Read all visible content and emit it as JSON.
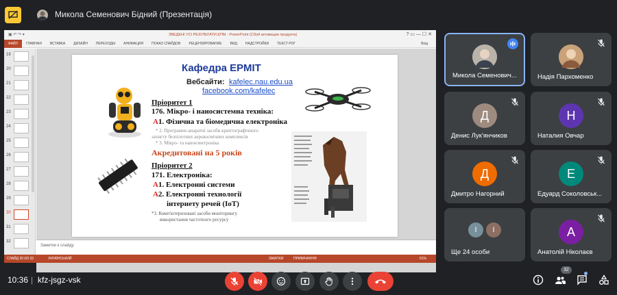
{
  "topbar": {
    "presenter_title": "Микола Семенович Бідний (Презентація)"
  },
  "powerpoint": {
    "doc_title": "ЗВЕДЕНІ УСІ РЕЗУЛЬТАТИ.ЕПМ - PowerPoint (Сбой активации продукта)",
    "file_tab": "ФАЙЛ",
    "ribbon_tabs": [
      "ГЛАВНАЯ",
      "ВСТАВКА",
      "ДИЗАЙН",
      "ПЕРЕХОДЫ",
      "АНИМАЦИЯ",
      "ПОКАЗ СЛАЙДОВ",
      "РЕЦЕНЗИРОВАНИЕ",
      "ВИД",
      "НАДСТРОЙКИ",
      "ТЕКСТ РОГ"
    ],
    "signin": "Вхід",
    "thumbnails": [
      "19",
      "20",
      "21",
      "22",
      "23",
      "24",
      "25",
      "26",
      "27",
      "28",
      "29",
      "30",
      "31",
      "32"
    ],
    "selected_thumb": "30",
    "notes_placeholder": "Заметки к слайду",
    "status_slide": "СЛАЙД 30 ИЗ 33",
    "status_lang": "УКРАЇНСЬКИЙ",
    "status_notes": "ЗАМІТКИ",
    "status_comments": "ПРИМІЧАННЯ",
    "zoom": "61%"
  },
  "slide": {
    "heading": "Кафедра ЕРМІТ",
    "websites_label": "Вебсайти:",
    "website1": "kafelec.nau.edu.ua",
    "website2": "facebook.com/kafelec",
    "priority1": "Пріоритет 1",
    "spec176": "176. Мікро- і наносистемна техніка:",
    "a1_marker": "А",
    "a1_text": "1. Фізична та біомедична електроніка",
    "prog_line1": "* 2. Програмно-апаратні засоби  криптографічного",
    "prog_line2": "захисту безпілотних  аерокосмічних комплексів",
    "micro_line": "* 3. Мікро- та наноелектроніка",
    "accredited": "Акредитовані на 5 років",
    "priority2": "Пріоритет 2",
    "spec171": "171. Електроніка:",
    "b1_marker": "А",
    "b1_text": "1. Електронні системи",
    "b2_marker": "А",
    "b2_text_line1": "2. Електронні технології",
    "b2_text_line2": "інтернету речей (IoT)",
    "comp_line1": "*3. Комп'ютеризовані засоби моніторингу",
    "comp_line2": "використання частотного ресурсу"
  },
  "participants": [
    {
      "name": "Микола Семенович...",
      "initial": "",
      "color": "#b9b3aa",
      "speaking": true
    },
    {
      "name": "Надія Пархоменко",
      "initial": "",
      "color": "#c9a27a",
      "speaking": false
    },
    {
      "name": "Денис Лук'янчиков",
      "initial": "Д",
      "color": "#9e8b7f",
      "speaking": false
    },
    {
      "name": "Наталия Овчар",
      "initial": "Н",
      "color": "#5e35b1",
      "speaking": false
    },
    {
      "name": "Дмитро Нагорний",
      "initial": "Д",
      "color": "#ef6c00",
      "speaking": false
    },
    {
      "name": "Едуард Соколовськ...",
      "initial": "Е",
      "color": "#00897b",
      "speaking": false
    },
    {
      "name": "Ще 24 особи",
      "initial": "",
      "color": "#455a64",
      "speaking": false
    },
    {
      "name": "Анатолій Ніколаєв",
      "initial": "А",
      "color": "#7b1fa2",
      "speaking": false
    }
  ],
  "overflow_initials": [
    "І",
    "І"
  ],
  "bottombar": {
    "time": "10:36",
    "separator": "|",
    "meeting_code": "kfz-jsgz-vsk",
    "participant_count": "32"
  },
  "colors": {
    "bg": "#202124",
    "tile": "#3c4043",
    "danger": "#ea4335",
    "accent": "#8ab4f8",
    "ppt": "#b7472a"
  }
}
